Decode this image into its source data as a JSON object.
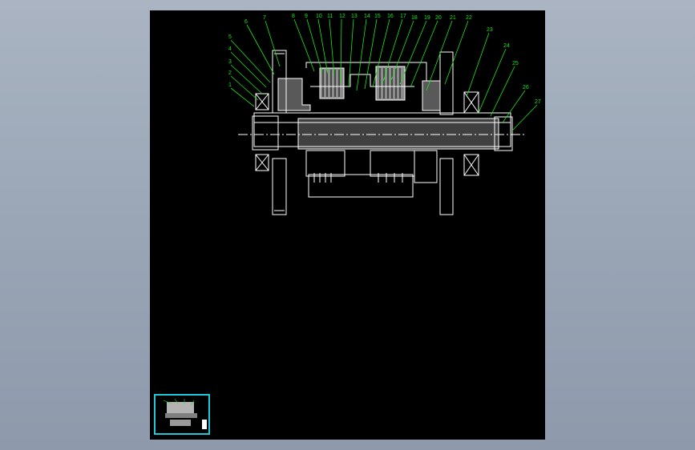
{
  "viewer": {
    "panel_bg": "#000000",
    "line_color": "#ffffff",
    "annotation_color": "#18e818",
    "thumbnail_border": "#21c7d6"
  },
  "part_labels": [
    "1",
    "2",
    "3",
    "4",
    "5",
    "6",
    "7",
    "8",
    "9",
    "10",
    "11",
    "12",
    "13",
    "14",
    "15",
    "16",
    "17",
    "18",
    "19",
    "20",
    "21",
    "22",
    "23",
    "24",
    "25",
    "26",
    "27"
  ]
}
